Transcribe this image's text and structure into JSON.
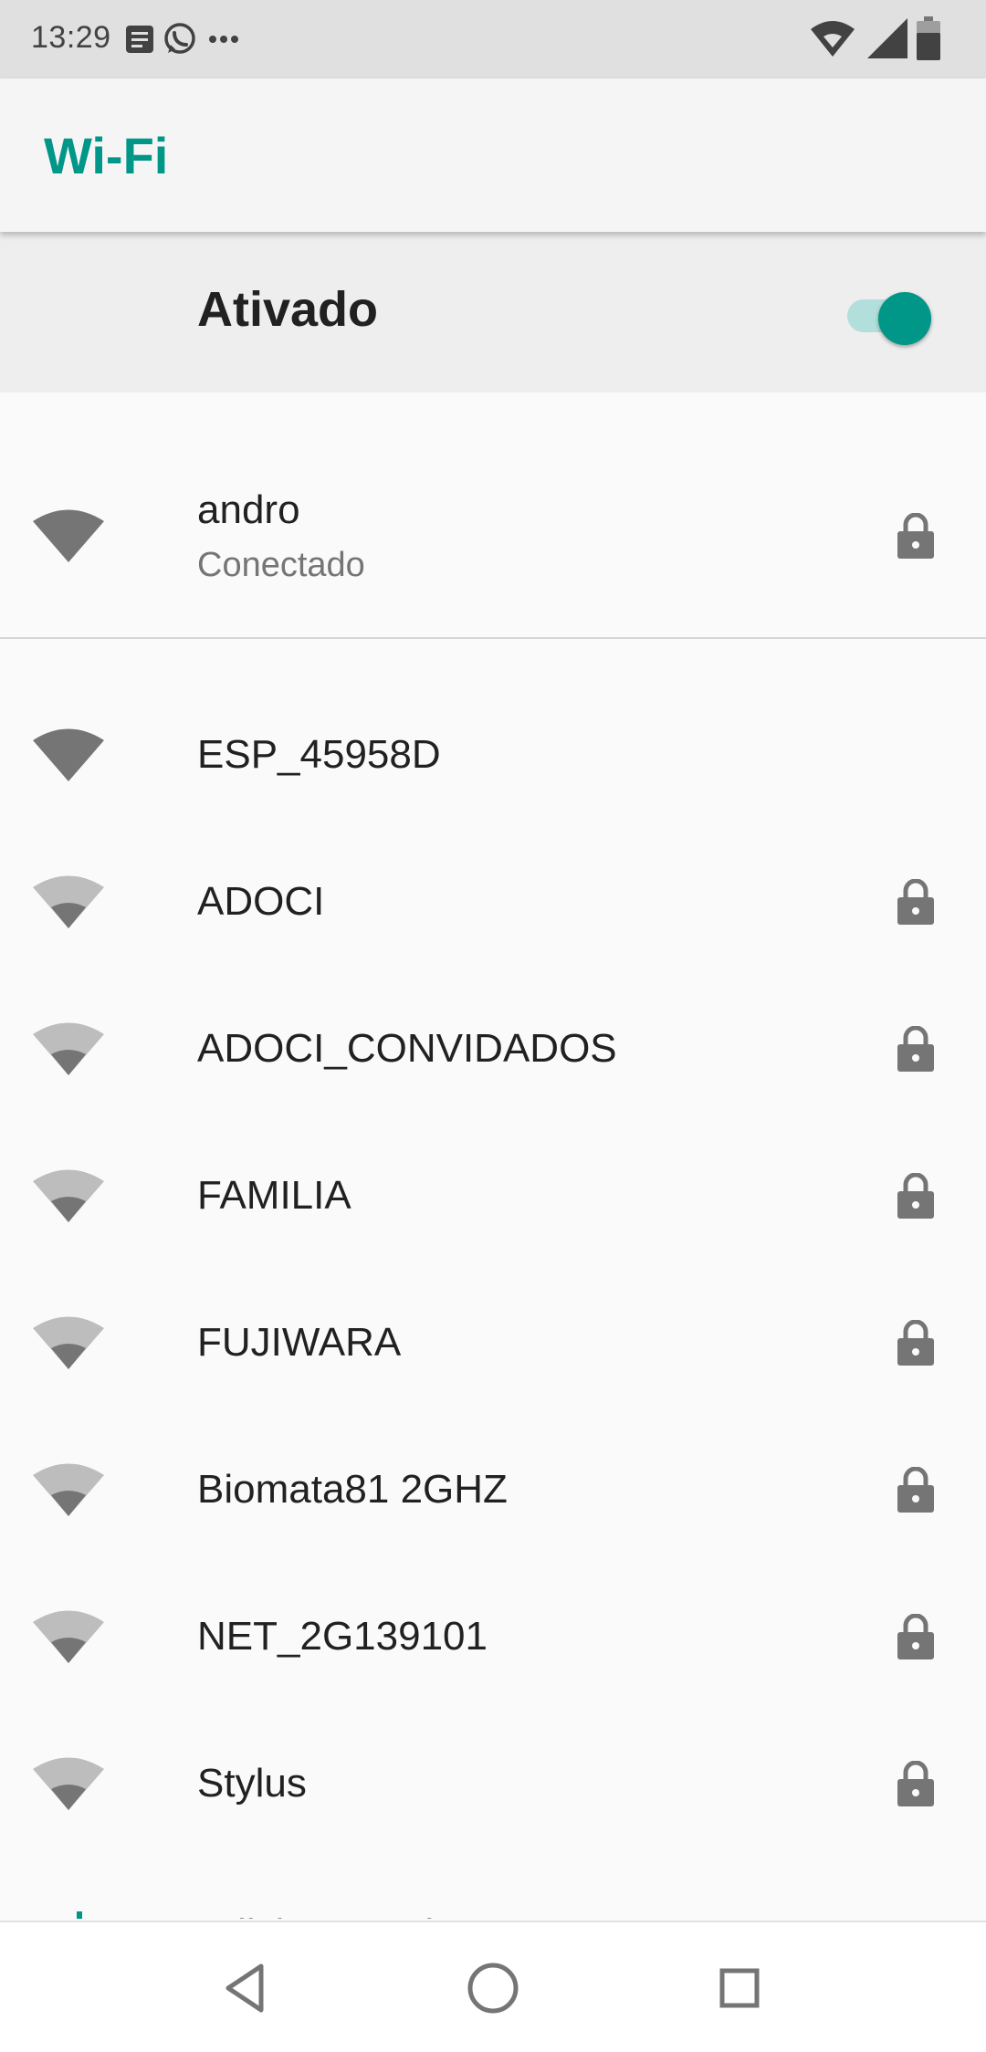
{
  "status_bar": {
    "time": "13:29",
    "left_icons": [
      "notes-icon",
      "whatsapp-icon",
      "more-dots-icon"
    ],
    "right_icons": [
      "wifi-status-icon",
      "cell-signal-icon",
      "battery-icon"
    ]
  },
  "app_bar": {
    "title": "Wi-Fi"
  },
  "master_switch": {
    "label": "Ativado",
    "state": "on"
  },
  "colors": {
    "accent": "#009688",
    "accent_light": "#b2dfdb",
    "icon_gray": "#757575",
    "icon_light": "#bdbdbd"
  },
  "connected_network": {
    "name": "andro",
    "status": "Conectado",
    "signal": "full",
    "secured": true
  },
  "networks": [
    {
      "name": "ESP_45958D",
      "signal": "full",
      "secured": false
    },
    {
      "name": "ADOCI",
      "signal": "weak",
      "secured": true
    },
    {
      "name": "ADOCI_CONVIDADOS",
      "signal": "weak",
      "secured": true
    },
    {
      "name": "FAMILIA",
      "signal": "weak",
      "secured": true
    },
    {
      "name": "FUJIWARA",
      "signal": "weak",
      "secured": true
    },
    {
      "name": "Biomata81 2GHZ",
      "signal": "weak",
      "secured": true
    },
    {
      "name": "NET_2G139101",
      "signal": "weak",
      "secured": true
    },
    {
      "name": "Stylus",
      "signal": "weak",
      "secured": true
    }
  ],
  "partial_item": {
    "label": "Adicionar rede"
  },
  "nav_bar": {
    "buttons": [
      "back",
      "home",
      "recents"
    ]
  }
}
